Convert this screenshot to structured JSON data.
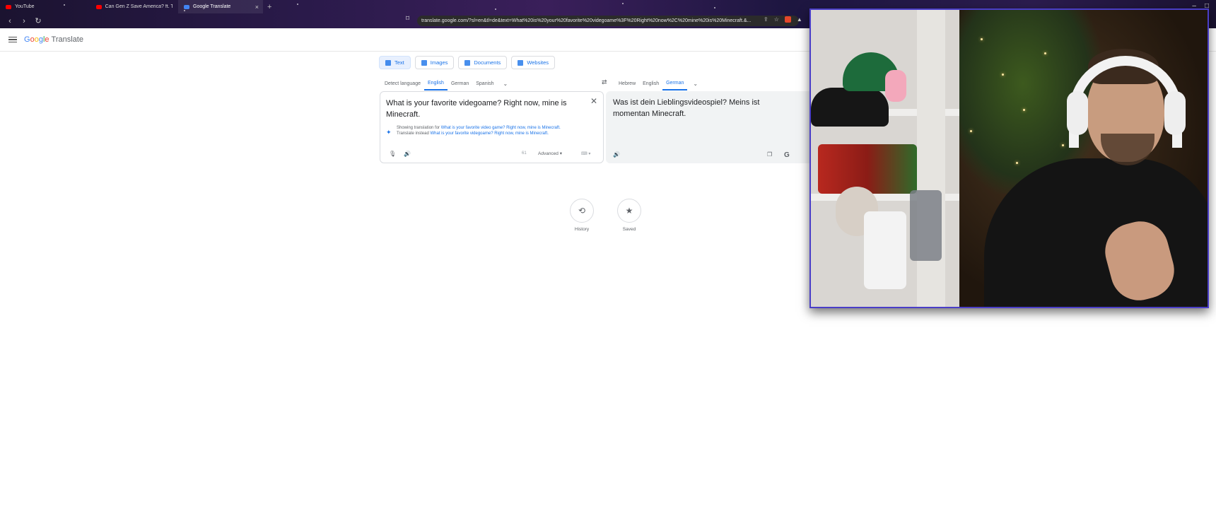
{
  "browser": {
    "tabs": [
      {
        "label": "YouTube",
        "active": false
      },
      {
        "label": "Can Gen Z Save America? ft. The Ro",
        "active": false
      },
      {
        "label": "Google Translate",
        "active": true
      }
    ],
    "url": "translate.google.com/?sl=en&tl=de&text=What%20is%20your%20favorite%20videgoame%3F%20Right%20now%2C%20mine%20is%20Minecraft.&..."
  },
  "app": {
    "name": "Translate"
  },
  "modes": [
    {
      "label": "Text",
      "active": true
    },
    {
      "label": "Images",
      "active": false
    },
    {
      "label": "Documents",
      "active": false
    },
    {
      "label": "Websites",
      "active": false
    }
  ],
  "source_languages": [
    "Detect language",
    "English",
    "German",
    "Spanish"
  ],
  "source_selected": "English",
  "target_languages": [
    "Hebrew",
    "English",
    "German"
  ],
  "target_selected": "German",
  "source": {
    "text": "What is your favorite videgoame? Right now, mine is Minecraft.",
    "suggest_prefix": "Showing translation for",
    "suggest_link": "What is your favorite video game? Right now, mine is Minecraft.",
    "instead_prefix": "Translate instead",
    "instead_link": "What is your favorite videgoame? Right now, mine is Minecraft.",
    "char_count": "61",
    "advanced_label": "Advanced"
  },
  "target": {
    "text": "Was ist dein Lieblingsvideospiel? Meins ist momentan Minecraft."
  },
  "history_label": "History",
  "saved_label": "Saved",
  "colors": {
    "accent": "#1a73e8",
    "cam_border": "#4a3ec7"
  }
}
